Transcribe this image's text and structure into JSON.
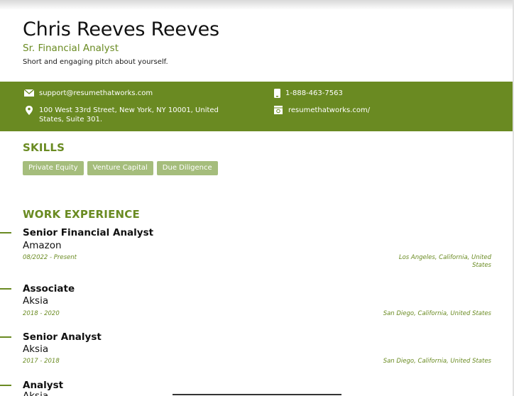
{
  "header": {
    "name": "Chris Reeves Reeves",
    "title": "Sr. Financial Analyst",
    "pitch": "Short and engaging pitch about yourself."
  },
  "contact": {
    "email": "support@resumethatworks.com",
    "phone": "1-888-463-7563",
    "address_line1": "100 West 33rd Street, New York, NY 10001, United",
    "address_line2": "States, Suite 301.",
    "website": "resumethatworks.com/"
  },
  "skills": {
    "heading": "SKILLS",
    "items": [
      "Private Equity",
      "Venture Capital",
      "Due Diligence"
    ]
  },
  "experience": {
    "heading": "WORK EXPERIENCE",
    "jobs": [
      {
        "role": "Senior Financial Analyst",
        "company": "Amazon",
        "dates": "08/2022 - Present",
        "location_line1": "Los Angeles, California, United",
        "location_line2": "States"
      },
      {
        "role": "Associate",
        "company": "Aksia",
        "dates": "2018 - 2020",
        "location_line1": "San Diego, California, United States",
        "location_line2": ""
      },
      {
        "role": "Senior Analyst",
        "company": "Aksia",
        "dates": "2017 - 2018",
        "location_line1": "San Diego, California, United States",
        "location_line2": ""
      },
      {
        "role": "Analyst",
        "company": "Aksia",
        "dates": "",
        "location_line1": "",
        "location_line2": ""
      }
    ]
  },
  "colors": {
    "accent": "#6a8a22",
    "tag": "#a5bd7c"
  },
  "icons": [
    "envelope-icon",
    "phone-icon",
    "location-pin-icon",
    "website-icon"
  ]
}
